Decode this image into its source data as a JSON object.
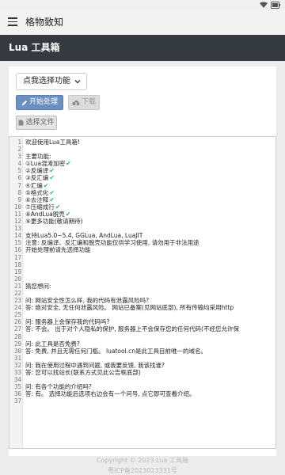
{
  "status": {
    "icons": [
      "wifi-icon",
      "battery-icon"
    ]
  },
  "appbar": {
    "title": "格物致知"
  },
  "header": {
    "title": "Lua 工具箱"
  },
  "controls": {
    "select_label": "点我选择功能",
    "start_label": "开始处理",
    "download_label": "下载",
    "file_label": "选择文件"
  },
  "editor": {
    "lines": [
      {
        "n": "1",
        "t": "欢迎使用Lua工具箱!"
      },
      {
        "n": "2",
        "t": ""
      },
      {
        "n": "3",
        "t": "主要功能:"
      },
      {
        "n": "4",
        "t": "①Lua混淆加密",
        "check": true
      },
      {
        "n": "5",
        "t": "②反编译",
        "check": true
      },
      {
        "n": "6",
        "t": "③反汇编",
        "check": true
      },
      {
        "n": "7",
        "t": "④汇编",
        "check": true
      },
      {
        "n": "8",
        "t": "⑤格式化",
        "check": true
      },
      {
        "n": "9",
        "t": "⑥去注释",
        "check": true
      },
      {
        "n": "10",
        "t": "⑦压缩成行",
        "check": true
      },
      {
        "n": "11",
        "t": "⑧AndLua脱壳",
        "check": true
      },
      {
        "n": "12",
        "t": "⑨更多功能(敬请期待)"
      },
      {
        "n": "13",
        "t": ""
      },
      {
        "n": "14",
        "t": "支持Lua5.0~5.4, GGLua, AndLua, LuaJIT"
      },
      {
        "n": "15",
        "t": "注意: 反编译、反汇编和脱壳功能仅供学习使用, 请勿用于非法用途"
      },
      {
        "n": "16",
        "t": "开始处理前请先选择功能"
      },
      {
        "n": "17",
        "t": ""
      },
      {
        "n": "18",
        "t": ""
      },
      {
        "n": "19",
        "t": ""
      },
      {
        "n": "20",
        "t": ""
      },
      {
        "n": "21",
        "t": "猜您想问:"
      },
      {
        "n": "22",
        "t": ""
      },
      {
        "n": "23",
        "t": "问: 网站安全性怎么样, 我的代码有泄露风险吗?"
      },
      {
        "n": "24",
        "t": "答: 绝对安全, 无任何泄露风险。 网站已备案(见网站底部), 所有传输均采用http"
      },
      {
        "n": "25",
        "t": ""
      },
      {
        "n": "26",
        "t": "问: 服务器上会保存我的代码吗?"
      },
      {
        "n": "27",
        "t": "答: 不会。 出于对个人隐私的保护, 服务器上不会保存您的任何代码(不经您允许保"
      },
      {
        "n": "28",
        "t": ""
      },
      {
        "n": "29",
        "t": "问: 此工具是否免费?"
      },
      {
        "n": "30",
        "t": "答: 免费, 并且无需任何门槛。 luatool.cn是此工具目前唯一的域名。"
      },
      {
        "n": "31",
        "t": ""
      },
      {
        "n": "32",
        "t": "问: 我在使用过程中遇到问题, 或我要反馈, 我该找谁?"
      },
      {
        "n": "33",
        "t": "答: 您可以找站长(联系方式见此公告框底部)"
      },
      {
        "n": "34",
        "t": ""
      },
      {
        "n": "35",
        "t": "问: 有各个功能的介绍吗?"
      },
      {
        "n": "36",
        "t": "答: 有。 选择功能后选项右边会有一个问号, 点它即可查看介绍。"
      },
      {
        "n": "37",
        "t": ""
      }
    ]
  },
  "footer": {
    "copyright": "Copyright © 2023 Lua 工具箱",
    "icp": "粤ICP备2023023331号"
  }
}
